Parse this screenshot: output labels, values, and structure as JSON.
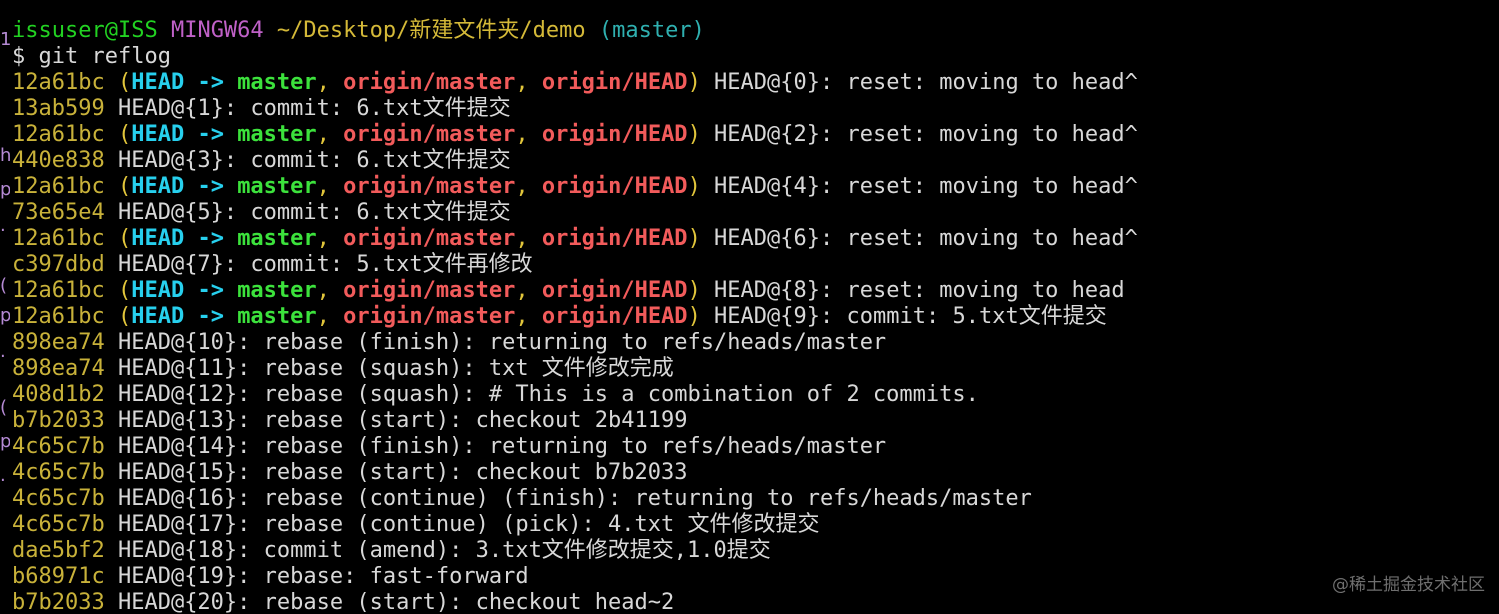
{
  "colors": {
    "default": "#d8d8d8",
    "green": "#22d222",
    "magenta": "#c061c8",
    "yellow": "#d4b938",
    "cyan": "#2fb0b0",
    "hash": "#c9b23a",
    "head_cyan": "#27d0ee",
    "branch_green": "#3ce23c",
    "remote_red": "#f25b5b",
    "paren_yellow": "#e2c63b",
    "left_strip": "#b58ad4",
    "watermark": "#6f6f6f"
  },
  "terminal": {
    "lines": [
      [
        {
          "t": "issuser@ISS",
          "c": "green"
        },
        {
          "t": " ",
          "c": "default"
        },
        {
          "t": "MINGW64",
          "c": "magenta"
        },
        {
          "t": " ",
          "c": "default"
        },
        {
          "t": "~/Desktop/新建文件夹/demo",
          "c": "yellow"
        },
        {
          "t": " ",
          "c": "default"
        },
        {
          "t": "(master)",
          "c": "cyan"
        }
      ],
      [
        {
          "t": "$ git reflog",
          "c": "default"
        }
      ],
      [
        {
          "t": "12a61bc",
          "c": "hash"
        },
        {
          "t": " (",
          "c": "paren_yellow"
        },
        {
          "t": "HEAD -> ",
          "c": "head_cyan",
          "b": true
        },
        {
          "t": "master",
          "c": "branch_green",
          "b": true
        },
        {
          "t": ", ",
          "c": "paren_yellow"
        },
        {
          "t": "origin/master",
          "c": "remote_red",
          "b": true
        },
        {
          "t": ", ",
          "c": "paren_yellow"
        },
        {
          "t": "origin/HEAD",
          "c": "remote_red",
          "b": true
        },
        {
          "t": ")",
          "c": "paren_yellow"
        },
        {
          "t": " HEAD@{0}: reset: moving to head^",
          "c": "default"
        }
      ],
      [
        {
          "t": "13ab599",
          "c": "hash"
        },
        {
          "t": " HEAD@{1}: commit: 6.txt文件提交",
          "c": "default"
        }
      ],
      [
        {
          "t": "12a61bc",
          "c": "hash"
        },
        {
          "t": " (",
          "c": "paren_yellow"
        },
        {
          "t": "HEAD -> ",
          "c": "head_cyan",
          "b": true
        },
        {
          "t": "master",
          "c": "branch_green",
          "b": true
        },
        {
          "t": ", ",
          "c": "paren_yellow"
        },
        {
          "t": "origin/master",
          "c": "remote_red",
          "b": true
        },
        {
          "t": ", ",
          "c": "paren_yellow"
        },
        {
          "t": "origin/HEAD",
          "c": "remote_red",
          "b": true
        },
        {
          "t": ")",
          "c": "paren_yellow"
        },
        {
          "t": " HEAD@{2}: reset: moving to head^",
          "c": "default"
        }
      ],
      [
        {
          "t": "440e838",
          "c": "hash"
        },
        {
          "t": " HEAD@{3}: commit: 6.txt文件提交",
          "c": "default"
        }
      ],
      [
        {
          "t": "12a61bc",
          "c": "hash"
        },
        {
          "t": " (",
          "c": "paren_yellow"
        },
        {
          "t": "HEAD -> ",
          "c": "head_cyan",
          "b": true
        },
        {
          "t": "master",
          "c": "branch_green",
          "b": true
        },
        {
          "t": ", ",
          "c": "paren_yellow"
        },
        {
          "t": "origin/master",
          "c": "remote_red",
          "b": true
        },
        {
          "t": ", ",
          "c": "paren_yellow"
        },
        {
          "t": "origin/HEAD",
          "c": "remote_red",
          "b": true
        },
        {
          "t": ")",
          "c": "paren_yellow"
        },
        {
          "t": " HEAD@{4}: reset: moving to head^",
          "c": "default"
        }
      ],
      [
        {
          "t": "73e65e4",
          "c": "hash"
        },
        {
          "t": " HEAD@{5}: commit: 6.txt文件提交",
          "c": "default"
        }
      ],
      [
        {
          "t": "12a61bc",
          "c": "hash"
        },
        {
          "t": " (",
          "c": "paren_yellow"
        },
        {
          "t": "HEAD -> ",
          "c": "head_cyan",
          "b": true
        },
        {
          "t": "master",
          "c": "branch_green",
          "b": true
        },
        {
          "t": ", ",
          "c": "paren_yellow"
        },
        {
          "t": "origin/master",
          "c": "remote_red",
          "b": true
        },
        {
          "t": ", ",
          "c": "paren_yellow"
        },
        {
          "t": "origin/HEAD",
          "c": "remote_red",
          "b": true
        },
        {
          "t": ")",
          "c": "paren_yellow"
        },
        {
          "t": " HEAD@{6}: reset: moving to head^",
          "c": "default"
        }
      ],
      [
        {
          "t": "c397dbd",
          "c": "hash"
        },
        {
          "t": " HEAD@{7}: commit: 5.txt文件再修改",
          "c": "default"
        }
      ],
      [
        {
          "t": "12a61bc",
          "c": "hash"
        },
        {
          "t": " (",
          "c": "paren_yellow"
        },
        {
          "t": "HEAD -> ",
          "c": "head_cyan",
          "b": true
        },
        {
          "t": "master",
          "c": "branch_green",
          "b": true
        },
        {
          "t": ", ",
          "c": "paren_yellow"
        },
        {
          "t": "origin/master",
          "c": "remote_red",
          "b": true
        },
        {
          "t": ", ",
          "c": "paren_yellow"
        },
        {
          "t": "origin/HEAD",
          "c": "remote_red",
          "b": true
        },
        {
          "t": ")",
          "c": "paren_yellow"
        },
        {
          "t": " HEAD@{8}: reset: moving to head",
          "c": "default"
        }
      ],
      [
        {
          "t": "12a61bc",
          "c": "hash"
        },
        {
          "t": " (",
          "c": "paren_yellow"
        },
        {
          "t": "HEAD -> ",
          "c": "head_cyan",
          "b": true
        },
        {
          "t": "master",
          "c": "branch_green",
          "b": true
        },
        {
          "t": ", ",
          "c": "paren_yellow"
        },
        {
          "t": "origin/master",
          "c": "remote_red",
          "b": true
        },
        {
          "t": ", ",
          "c": "paren_yellow"
        },
        {
          "t": "origin/HEAD",
          "c": "remote_red",
          "b": true
        },
        {
          "t": ")",
          "c": "paren_yellow"
        },
        {
          "t": " HEAD@{9}: commit: 5.txt文件提交",
          "c": "default"
        }
      ],
      [
        {
          "t": "898ea74",
          "c": "hash"
        },
        {
          "t": " HEAD@{10}: rebase (finish): returning to refs/heads/master",
          "c": "default"
        }
      ],
      [
        {
          "t": "898ea74",
          "c": "hash"
        },
        {
          "t": " HEAD@{11}: rebase (squash): txt 文件修改完成",
          "c": "default"
        }
      ],
      [
        {
          "t": "408d1b2",
          "c": "hash"
        },
        {
          "t": " HEAD@{12}: rebase (squash): # This is a combination of 2 commits.",
          "c": "default"
        }
      ],
      [
        {
          "t": "b7b2033",
          "c": "hash"
        },
        {
          "t": " HEAD@{13}: rebase (start): checkout 2b41199",
          "c": "default"
        }
      ],
      [
        {
          "t": "4c65c7b",
          "c": "hash"
        },
        {
          "t": " HEAD@{14}: rebase (finish): returning to refs/heads/master",
          "c": "default"
        }
      ],
      [
        {
          "t": "4c65c7b",
          "c": "hash"
        },
        {
          "t": " HEAD@{15}: rebase (start): checkout b7b2033",
          "c": "default"
        }
      ],
      [
        {
          "t": "4c65c7b",
          "c": "hash"
        },
        {
          "t": " HEAD@{16}: rebase (continue) (finish): returning to refs/heads/master",
          "c": "default"
        }
      ],
      [
        {
          "t": "4c65c7b",
          "c": "hash"
        },
        {
          "t": " HEAD@{17}: rebase (continue) (pick): 4.txt 文件修改提交",
          "c": "default"
        }
      ],
      [
        {
          "t": "dae5bf2",
          "c": "hash"
        },
        {
          "t": " HEAD@{18}: commit (amend): 3.txt文件修改提交,1.0提交",
          "c": "default"
        }
      ],
      [
        {
          "t": "b68971c",
          "c": "hash"
        },
        {
          "t": " HEAD@{19}: rebase: fast-forward",
          "c": "default"
        }
      ],
      [
        {
          "t": "b7b2033",
          "c": "hash"
        },
        {
          "t": " HEAD@{20}: rebase (start): checkout head~2",
          "c": "default"
        }
      ]
    ]
  },
  "left_strip": {
    "glyphs": [
      "1",
      "h",
      "p",
      ".",
      "(",
      "p",
      ".",
      "(",
      "p",
      "."
    ]
  },
  "watermark": "@稀土掘金技术社区"
}
